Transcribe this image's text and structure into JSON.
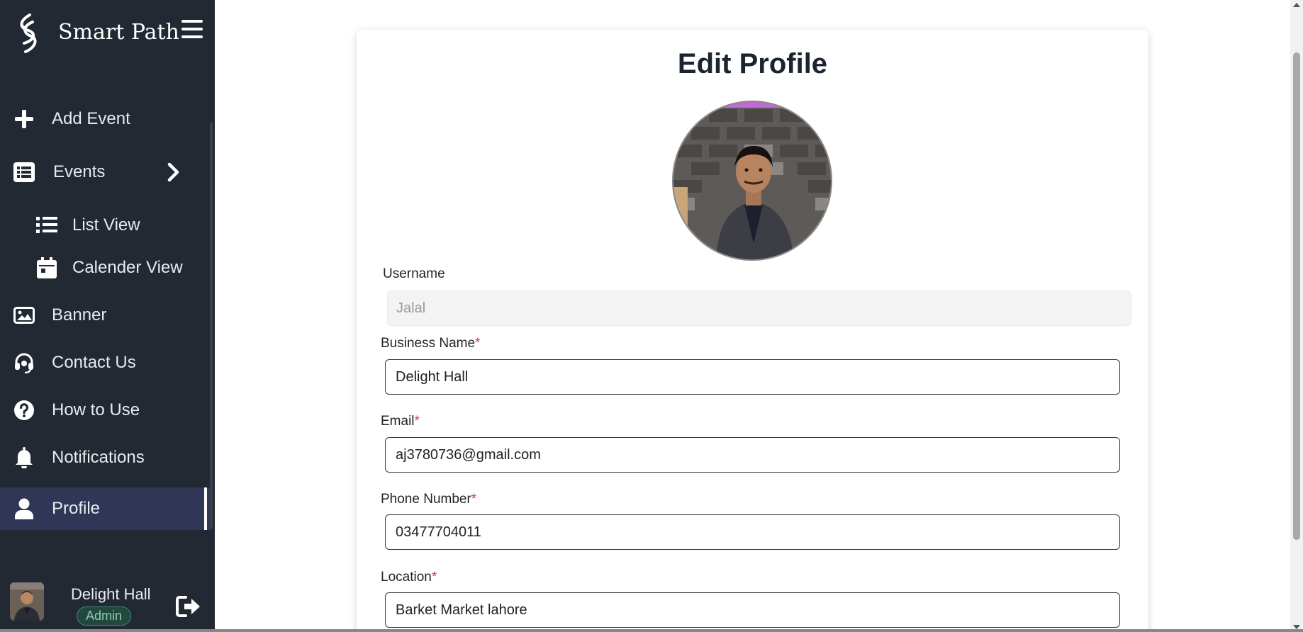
{
  "brand": {
    "name": "Smart Path"
  },
  "sidebar": {
    "items": [
      {
        "label": "Add Event"
      },
      {
        "label": "Events"
      },
      {
        "label": "List View"
      },
      {
        "label": "Calender View"
      },
      {
        "label": "Banner"
      },
      {
        "label": "Contact Us"
      },
      {
        "label": "How to Use"
      },
      {
        "label": "Notifications"
      },
      {
        "label": "Profile"
      }
    ],
    "active": "Profile"
  },
  "user": {
    "name": "Delight Hall",
    "role": "Admin"
  },
  "page": {
    "title": "Edit Profile",
    "fields": {
      "username": {
        "label": "Username",
        "value": "Jalal"
      },
      "business_name": {
        "label": "Business Name",
        "value": "Delight Hall"
      },
      "email": {
        "label": "Email",
        "value": "aj3780736@gmail.com"
      },
      "phone": {
        "label": "Phone Number",
        "value": "03477704011"
      },
      "location": {
        "label": "Location",
        "value": "Barket Market lahore"
      }
    },
    "required_mark": "*"
  },
  "colors": {
    "sidebar_bg": "#222933",
    "active_bg": "#2f3656",
    "required": "#dc3545",
    "badge": "#23483e"
  },
  "icons": [
    "logo-icon",
    "menu-icon",
    "plus-icon",
    "list-icon",
    "chevron-right-icon",
    "list-view-icon",
    "calendar-icon",
    "image-icon",
    "headset-icon",
    "question-icon",
    "bell-icon",
    "user-icon",
    "logout-icon"
  ]
}
